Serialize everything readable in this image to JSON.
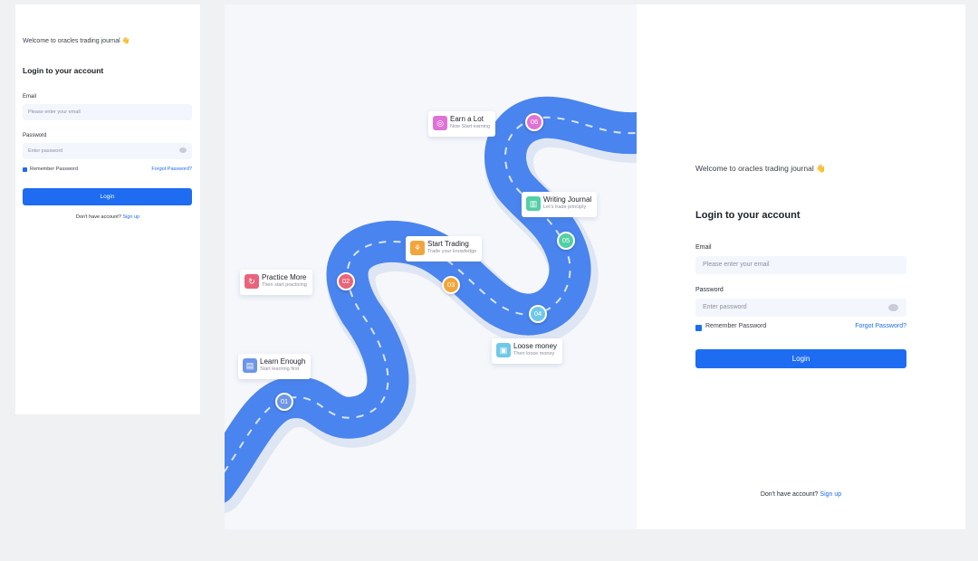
{
  "small_login": {
    "welcome": "Welcome to oracles trading journal 👋",
    "title": "Login to your account",
    "email_label": "Email",
    "email_placeholder": "Please enter your email",
    "password_label": "Password",
    "password_placeholder": "Enter password",
    "remember": "Remember Password",
    "forgot": "Forgot Password?",
    "login_button": "Login",
    "no_account": "Don't have account?",
    "sign_up": "Sign up"
  },
  "large_login": {
    "welcome": "Welcome to oracles trading journal 👋",
    "title": "Login to your account",
    "email_label": "Email",
    "email_placeholder": "Please enter your email",
    "password_label": "Password",
    "password_placeholder": "Enter password",
    "remember": "Remember Password",
    "forgot": "Forgot Password?",
    "login_button": "Login",
    "no_account": "Don't have account?",
    "sign_up": "Sign up"
  },
  "roadmap": {
    "road_color": "#4a84ee",
    "steps": [
      {
        "number": "01",
        "title": "Learn Enough",
        "subtitle": "Start learning first",
        "icon": "book-icon",
        "color": "#6d95e8"
      },
      {
        "number": "02",
        "title": "Practice More",
        "subtitle": "Then start practicing",
        "icon": "refresh-icon",
        "color": "#e9647a"
      },
      {
        "number": "03",
        "title": "Start Trading",
        "subtitle": "Trade your knowledge",
        "icon": "trading-icon",
        "color": "#f2a53a"
      },
      {
        "number": "04",
        "title": "Loose money",
        "subtitle": "Then loose money",
        "icon": "money-icon",
        "color": "#6fc8e8"
      },
      {
        "number": "05",
        "title": "Writing Journal",
        "subtitle": "Let's trade principly",
        "icon": "journal-icon",
        "color": "#52cfa5"
      },
      {
        "number": "06",
        "title": "Earn a Lot",
        "subtitle": "Now Start earning",
        "icon": "target-icon",
        "color": "#e072d6"
      }
    ]
  },
  "colors": {
    "accent": "#1d6cf2",
    "input_bg": "#f3f6fc",
    "page_bg": "#f0f1f3"
  }
}
